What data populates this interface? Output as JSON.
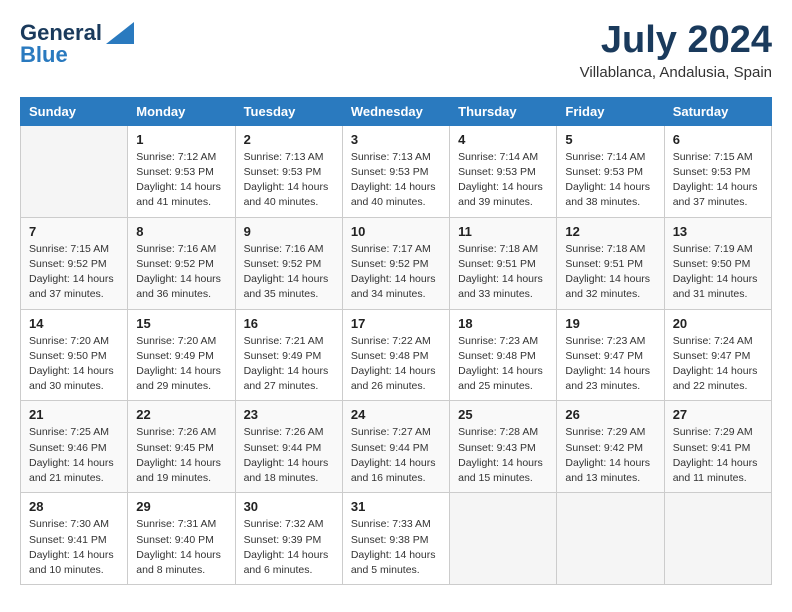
{
  "header": {
    "logo_line1": "General",
    "logo_line2": "Blue",
    "month_year": "July 2024",
    "location": "Villablanca, Andalusia, Spain"
  },
  "days_of_week": [
    "Sunday",
    "Monday",
    "Tuesday",
    "Wednesday",
    "Thursday",
    "Friday",
    "Saturday"
  ],
  "weeks": [
    [
      {
        "num": "",
        "empty": true
      },
      {
        "num": "1",
        "sunrise": "Sunrise: 7:12 AM",
        "sunset": "Sunset: 9:53 PM",
        "daylight": "Daylight: 14 hours and 41 minutes."
      },
      {
        "num": "2",
        "sunrise": "Sunrise: 7:13 AM",
        "sunset": "Sunset: 9:53 PM",
        "daylight": "Daylight: 14 hours and 40 minutes."
      },
      {
        "num": "3",
        "sunrise": "Sunrise: 7:13 AM",
        "sunset": "Sunset: 9:53 PM",
        "daylight": "Daylight: 14 hours and 40 minutes."
      },
      {
        "num": "4",
        "sunrise": "Sunrise: 7:14 AM",
        "sunset": "Sunset: 9:53 PM",
        "daylight": "Daylight: 14 hours and 39 minutes."
      },
      {
        "num": "5",
        "sunrise": "Sunrise: 7:14 AM",
        "sunset": "Sunset: 9:53 PM",
        "daylight": "Daylight: 14 hours and 38 minutes."
      },
      {
        "num": "6",
        "sunrise": "Sunrise: 7:15 AM",
        "sunset": "Sunset: 9:53 PM",
        "daylight": "Daylight: 14 hours and 37 minutes."
      }
    ],
    [
      {
        "num": "7",
        "sunrise": "Sunrise: 7:15 AM",
        "sunset": "Sunset: 9:52 PM",
        "daylight": "Daylight: 14 hours and 37 minutes."
      },
      {
        "num": "8",
        "sunrise": "Sunrise: 7:16 AM",
        "sunset": "Sunset: 9:52 PM",
        "daylight": "Daylight: 14 hours and 36 minutes."
      },
      {
        "num": "9",
        "sunrise": "Sunrise: 7:16 AM",
        "sunset": "Sunset: 9:52 PM",
        "daylight": "Daylight: 14 hours and 35 minutes."
      },
      {
        "num": "10",
        "sunrise": "Sunrise: 7:17 AM",
        "sunset": "Sunset: 9:52 PM",
        "daylight": "Daylight: 14 hours and 34 minutes."
      },
      {
        "num": "11",
        "sunrise": "Sunrise: 7:18 AM",
        "sunset": "Sunset: 9:51 PM",
        "daylight": "Daylight: 14 hours and 33 minutes."
      },
      {
        "num": "12",
        "sunrise": "Sunrise: 7:18 AM",
        "sunset": "Sunset: 9:51 PM",
        "daylight": "Daylight: 14 hours and 32 minutes."
      },
      {
        "num": "13",
        "sunrise": "Sunrise: 7:19 AM",
        "sunset": "Sunset: 9:50 PM",
        "daylight": "Daylight: 14 hours and 31 minutes."
      }
    ],
    [
      {
        "num": "14",
        "sunrise": "Sunrise: 7:20 AM",
        "sunset": "Sunset: 9:50 PM",
        "daylight": "Daylight: 14 hours and 30 minutes."
      },
      {
        "num": "15",
        "sunrise": "Sunrise: 7:20 AM",
        "sunset": "Sunset: 9:49 PM",
        "daylight": "Daylight: 14 hours and 29 minutes."
      },
      {
        "num": "16",
        "sunrise": "Sunrise: 7:21 AM",
        "sunset": "Sunset: 9:49 PM",
        "daylight": "Daylight: 14 hours and 27 minutes."
      },
      {
        "num": "17",
        "sunrise": "Sunrise: 7:22 AM",
        "sunset": "Sunset: 9:48 PM",
        "daylight": "Daylight: 14 hours and 26 minutes."
      },
      {
        "num": "18",
        "sunrise": "Sunrise: 7:23 AM",
        "sunset": "Sunset: 9:48 PM",
        "daylight": "Daylight: 14 hours and 25 minutes."
      },
      {
        "num": "19",
        "sunrise": "Sunrise: 7:23 AM",
        "sunset": "Sunset: 9:47 PM",
        "daylight": "Daylight: 14 hours and 23 minutes."
      },
      {
        "num": "20",
        "sunrise": "Sunrise: 7:24 AM",
        "sunset": "Sunset: 9:47 PM",
        "daylight": "Daylight: 14 hours and 22 minutes."
      }
    ],
    [
      {
        "num": "21",
        "sunrise": "Sunrise: 7:25 AM",
        "sunset": "Sunset: 9:46 PM",
        "daylight": "Daylight: 14 hours and 21 minutes."
      },
      {
        "num": "22",
        "sunrise": "Sunrise: 7:26 AM",
        "sunset": "Sunset: 9:45 PM",
        "daylight": "Daylight: 14 hours and 19 minutes."
      },
      {
        "num": "23",
        "sunrise": "Sunrise: 7:26 AM",
        "sunset": "Sunset: 9:44 PM",
        "daylight": "Daylight: 14 hours and 18 minutes."
      },
      {
        "num": "24",
        "sunrise": "Sunrise: 7:27 AM",
        "sunset": "Sunset: 9:44 PM",
        "daylight": "Daylight: 14 hours and 16 minutes."
      },
      {
        "num": "25",
        "sunrise": "Sunrise: 7:28 AM",
        "sunset": "Sunset: 9:43 PM",
        "daylight": "Daylight: 14 hours and 15 minutes."
      },
      {
        "num": "26",
        "sunrise": "Sunrise: 7:29 AM",
        "sunset": "Sunset: 9:42 PM",
        "daylight": "Daylight: 14 hours and 13 minutes."
      },
      {
        "num": "27",
        "sunrise": "Sunrise: 7:29 AM",
        "sunset": "Sunset: 9:41 PM",
        "daylight": "Daylight: 14 hours and 11 minutes."
      }
    ],
    [
      {
        "num": "28",
        "sunrise": "Sunrise: 7:30 AM",
        "sunset": "Sunset: 9:41 PM",
        "daylight": "Daylight: 14 hours and 10 minutes."
      },
      {
        "num": "29",
        "sunrise": "Sunrise: 7:31 AM",
        "sunset": "Sunset: 9:40 PM",
        "daylight": "Daylight: 14 hours and 8 minutes."
      },
      {
        "num": "30",
        "sunrise": "Sunrise: 7:32 AM",
        "sunset": "Sunset: 9:39 PM",
        "daylight": "Daylight: 14 hours and 6 minutes."
      },
      {
        "num": "31",
        "sunrise": "Sunrise: 7:33 AM",
        "sunset": "Sunset: 9:38 PM",
        "daylight": "Daylight: 14 hours and 5 minutes."
      },
      {
        "num": "",
        "empty": true
      },
      {
        "num": "",
        "empty": true
      },
      {
        "num": "",
        "empty": true
      }
    ]
  ]
}
